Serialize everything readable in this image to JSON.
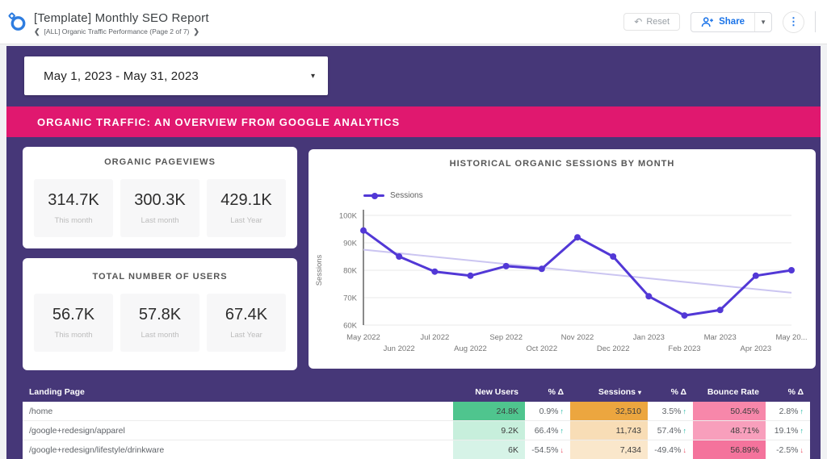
{
  "header": {
    "title": "[Template] Monthly SEO Report",
    "breadcrumb": "[ALL] Organic Traffic Performance (Page 2 of 7)",
    "chevron_left": "❮",
    "chevron_right": "❯",
    "reset_label": "Reset",
    "undo_glyph": "↶",
    "share_label": "Share",
    "share_caret": "▼",
    "kebab_glyph": "⋮",
    "accent_color": "#1a73e8"
  },
  "canvas": {
    "background_color": "#463778",
    "banner_color": "#e0186f",
    "date_range": "May 1, 2023 - May 31, 2023",
    "date_caret": "▾",
    "banner": "ORGANIC TRAFFIC: AN OVERVIEW FROM GOOGLE ANALYTICS"
  },
  "kpi_cards": [
    {
      "title": "ORGANIC PAGEVIEWS",
      "metrics": [
        {
          "value": "314.7K",
          "label": "This month"
        },
        {
          "value": "300.3K",
          "label": "Last month"
        },
        {
          "value": "429.1K",
          "label": "Last Year"
        }
      ]
    },
    {
      "title": "TOTAL NUMBER OF USERS",
      "metrics": [
        {
          "value": "56.7K",
          "label": "This month"
        },
        {
          "value": "57.8K",
          "label": "Last month"
        },
        {
          "value": "67.4K",
          "label": "Last Year"
        }
      ]
    }
  ],
  "chart_data": {
    "type": "line",
    "title": "HISTORICAL ORGANIC SESSIONS BY MONTH",
    "legend": "Sessions",
    "ylabel": "Sessions",
    "ylim": [
      60000,
      100000
    ],
    "yticks": [
      "60K",
      "70K",
      "80K",
      "90K",
      "100K"
    ],
    "x": [
      "May 2022",
      "Jun 2022",
      "Jul 2022",
      "Aug 2022",
      "Sep 2022",
      "Oct 2022",
      "Nov 2022",
      "Dec 2022",
      "Jan 2023",
      "Feb 2023",
      "Mar 2023",
      "Apr 2023",
      "May 20..."
    ],
    "series": [
      {
        "name": "Sessions",
        "values": [
          94500,
          85000,
          79500,
          78000,
          81500,
          80500,
          92000,
          85000,
          70500,
          63500,
          65500,
          78000,
          80000
        ]
      }
    ],
    "trendline": {
      "start": 87500,
      "end": 71800
    },
    "colors": {
      "line": "#5238d6",
      "trend": "#cbc5f1"
    },
    "grid": true,
    "legend_position": "top-left"
  },
  "table": {
    "columns": [
      {
        "label": "Landing Page"
      },
      {
        "label": "New Users"
      },
      {
        "label": "% Δ"
      },
      {
        "label": "Sessions",
        "sort": "▾"
      },
      {
        "label": "% Δ"
      },
      {
        "label": "Bounce Rate"
      },
      {
        "label": "% Δ"
      }
    ],
    "rows": [
      {
        "page": "/home",
        "new_users": {
          "text": "24.8K",
          "bg": "#4fc58e"
        },
        "new_users_delta": {
          "text": "0.9%",
          "arrow": "↑",
          "arrow_color": "#12b5a0"
        },
        "sessions": {
          "text": "32,510",
          "bg": "#eca63f"
        },
        "sessions_delta": {
          "text": "3.5%",
          "arrow": "↑",
          "arrow_color": "#12b5a0"
        },
        "bounce_rate": {
          "text": "50.45%",
          "bg": "#f787aa"
        },
        "bounce_delta": {
          "text": "2.8%",
          "arrow": "↑",
          "arrow_color": "#12b5a0"
        }
      },
      {
        "page": "/google+redesign/apparel",
        "new_users": {
          "text": "9.2K",
          "bg": "#c7efdc"
        },
        "new_users_delta": {
          "text": "66.4%",
          "arrow": "↑",
          "arrow_color": "#12b5a0"
        },
        "sessions": {
          "text": "11,743",
          "bg": "#f8ddb6"
        },
        "sessions_delta": {
          "text": "57.4%",
          "arrow": "↑",
          "arrow_color": "#12b5a0"
        },
        "bounce_rate": {
          "text": "48.71%",
          "bg": "#f89fbc"
        },
        "bounce_delta": {
          "text": "19.1%",
          "arrow": "↑",
          "arrow_color": "#12b5a0"
        }
      },
      {
        "page": "/google+redesign/lifestyle/drinkware",
        "new_users": {
          "text": "6K",
          "bg": "#d6f3e7"
        },
        "new_users_delta": {
          "text": "-54.5%",
          "arrow": "↓",
          "arrow_color": "#e8495f"
        },
        "sessions": {
          "text": "7,434",
          "bg": "#fae7cb"
        },
        "sessions_delta": {
          "text": "-49.4%",
          "arrow": "↓",
          "arrow_color": "#e8495f"
        },
        "bounce_rate": {
          "text": "56.89%",
          "bg": "#f4739c"
        },
        "bounce_delta": {
          "text": "-2.5%",
          "arrow": "↓",
          "arrow_color": "#e8495f"
        }
      }
    ]
  }
}
